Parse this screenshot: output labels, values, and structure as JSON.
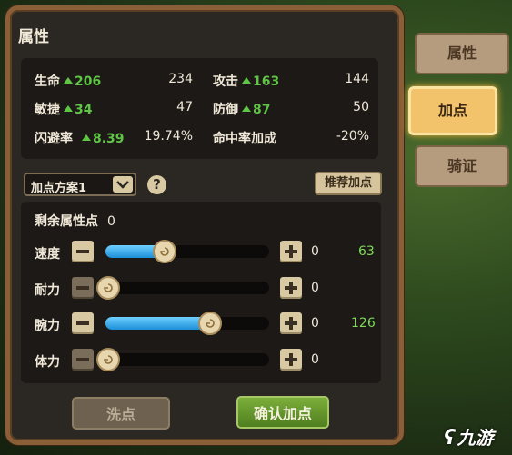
{
  "panel": {
    "title": "属性"
  },
  "stats": [
    {
      "label": "生命",
      "bonus": "206",
      "value": "234"
    },
    {
      "label": "攻击",
      "bonus": "163",
      "value": "144"
    },
    {
      "label": "敏捷",
      "bonus": "34",
      "value": "47"
    },
    {
      "label": "防御",
      "bonus": "87",
      "value": "50"
    },
    {
      "label": "闪避率",
      "bonus": "8.39",
      "value": "19.74%"
    },
    {
      "label": "命中率加成",
      "bonus": "",
      "value": "-20%"
    }
  ],
  "scheme": {
    "selected": "加点方案1",
    "help": "?"
  },
  "recommend_label": "推荐加点",
  "remaining": {
    "label": "剩余属性点",
    "value": "0"
  },
  "attributes": [
    {
      "label": "速度",
      "allocated": "0",
      "total": "63",
      "fill": 0.34
    },
    {
      "label": "耐力",
      "allocated": "0",
      "total": "",
      "fill": 0.0
    },
    {
      "label": "腕力",
      "allocated": "0",
      "total": "126",
      "fill": 0.66
    },
    {
      "label": "体力",
      "allocated": "0",
      "total": "",
      "fill": 0.0
    }
  ],
  "buttons": {
    "reset": "洗点",
    "confirm": "确认加点"
  },
  "tabs": [
    {
      "label": "属性",
      "active": false
    },
    {
      "label": "加点",
      "active": true
    },
    {
      "label": "骑证",
      "active": false
    }
  ],
  "watermark": "九游",
  "colors": {
    "bonus_green": "#5fc545",
    "slider_blue": "#1c8fd8",
    "active_tab": "#f2c36a"
  }
}
